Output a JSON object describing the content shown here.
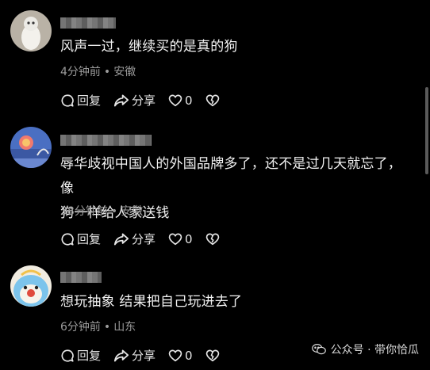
{
  "comments": [
    {
      "text_lines": [
        "风声一过，继续买的是真的狗"
      ],
      "time": "4分钟前",
      "location": "安徽",
      "reply_label": "回复",
      "share_label": "分享",
      "like_count": "0"
    },
    {
      "text_lines": [
        "辱华歧视中国人的外国品牌多了，还不是过几天就忘了，像",
        "狗一样给人家送钱"
      ],
      "time": "38分钟前",
      "location": "安徽",
      "reply_label": "回复",
      "share_label": "分享",
      "like_count": "0"
    },
    {
      "text_lines": [
        "想玩抽象 结果把自己玩进去了"
      ],
      "time": "6分钟前",
      "location": "山东",
      "reply_label": "回复",
      "share_label": "分享",
      "like_count": "0"
    }
  ],
  "meta_separator": "•",
  "watermark": "公众号 · 带你恰瓜",
  "icons": {
    "reply": "reply-icon",
    "share": "share-icon",
    "like": "heart-icon",
    "dislike": "broken-heart-icon",
    "watermark": "wechat-icon"
  },
  "colors": {
    "background": "#000000",
    "text": "#f2f2f2",
    "meta": "#9b9b9b"
  }
}
